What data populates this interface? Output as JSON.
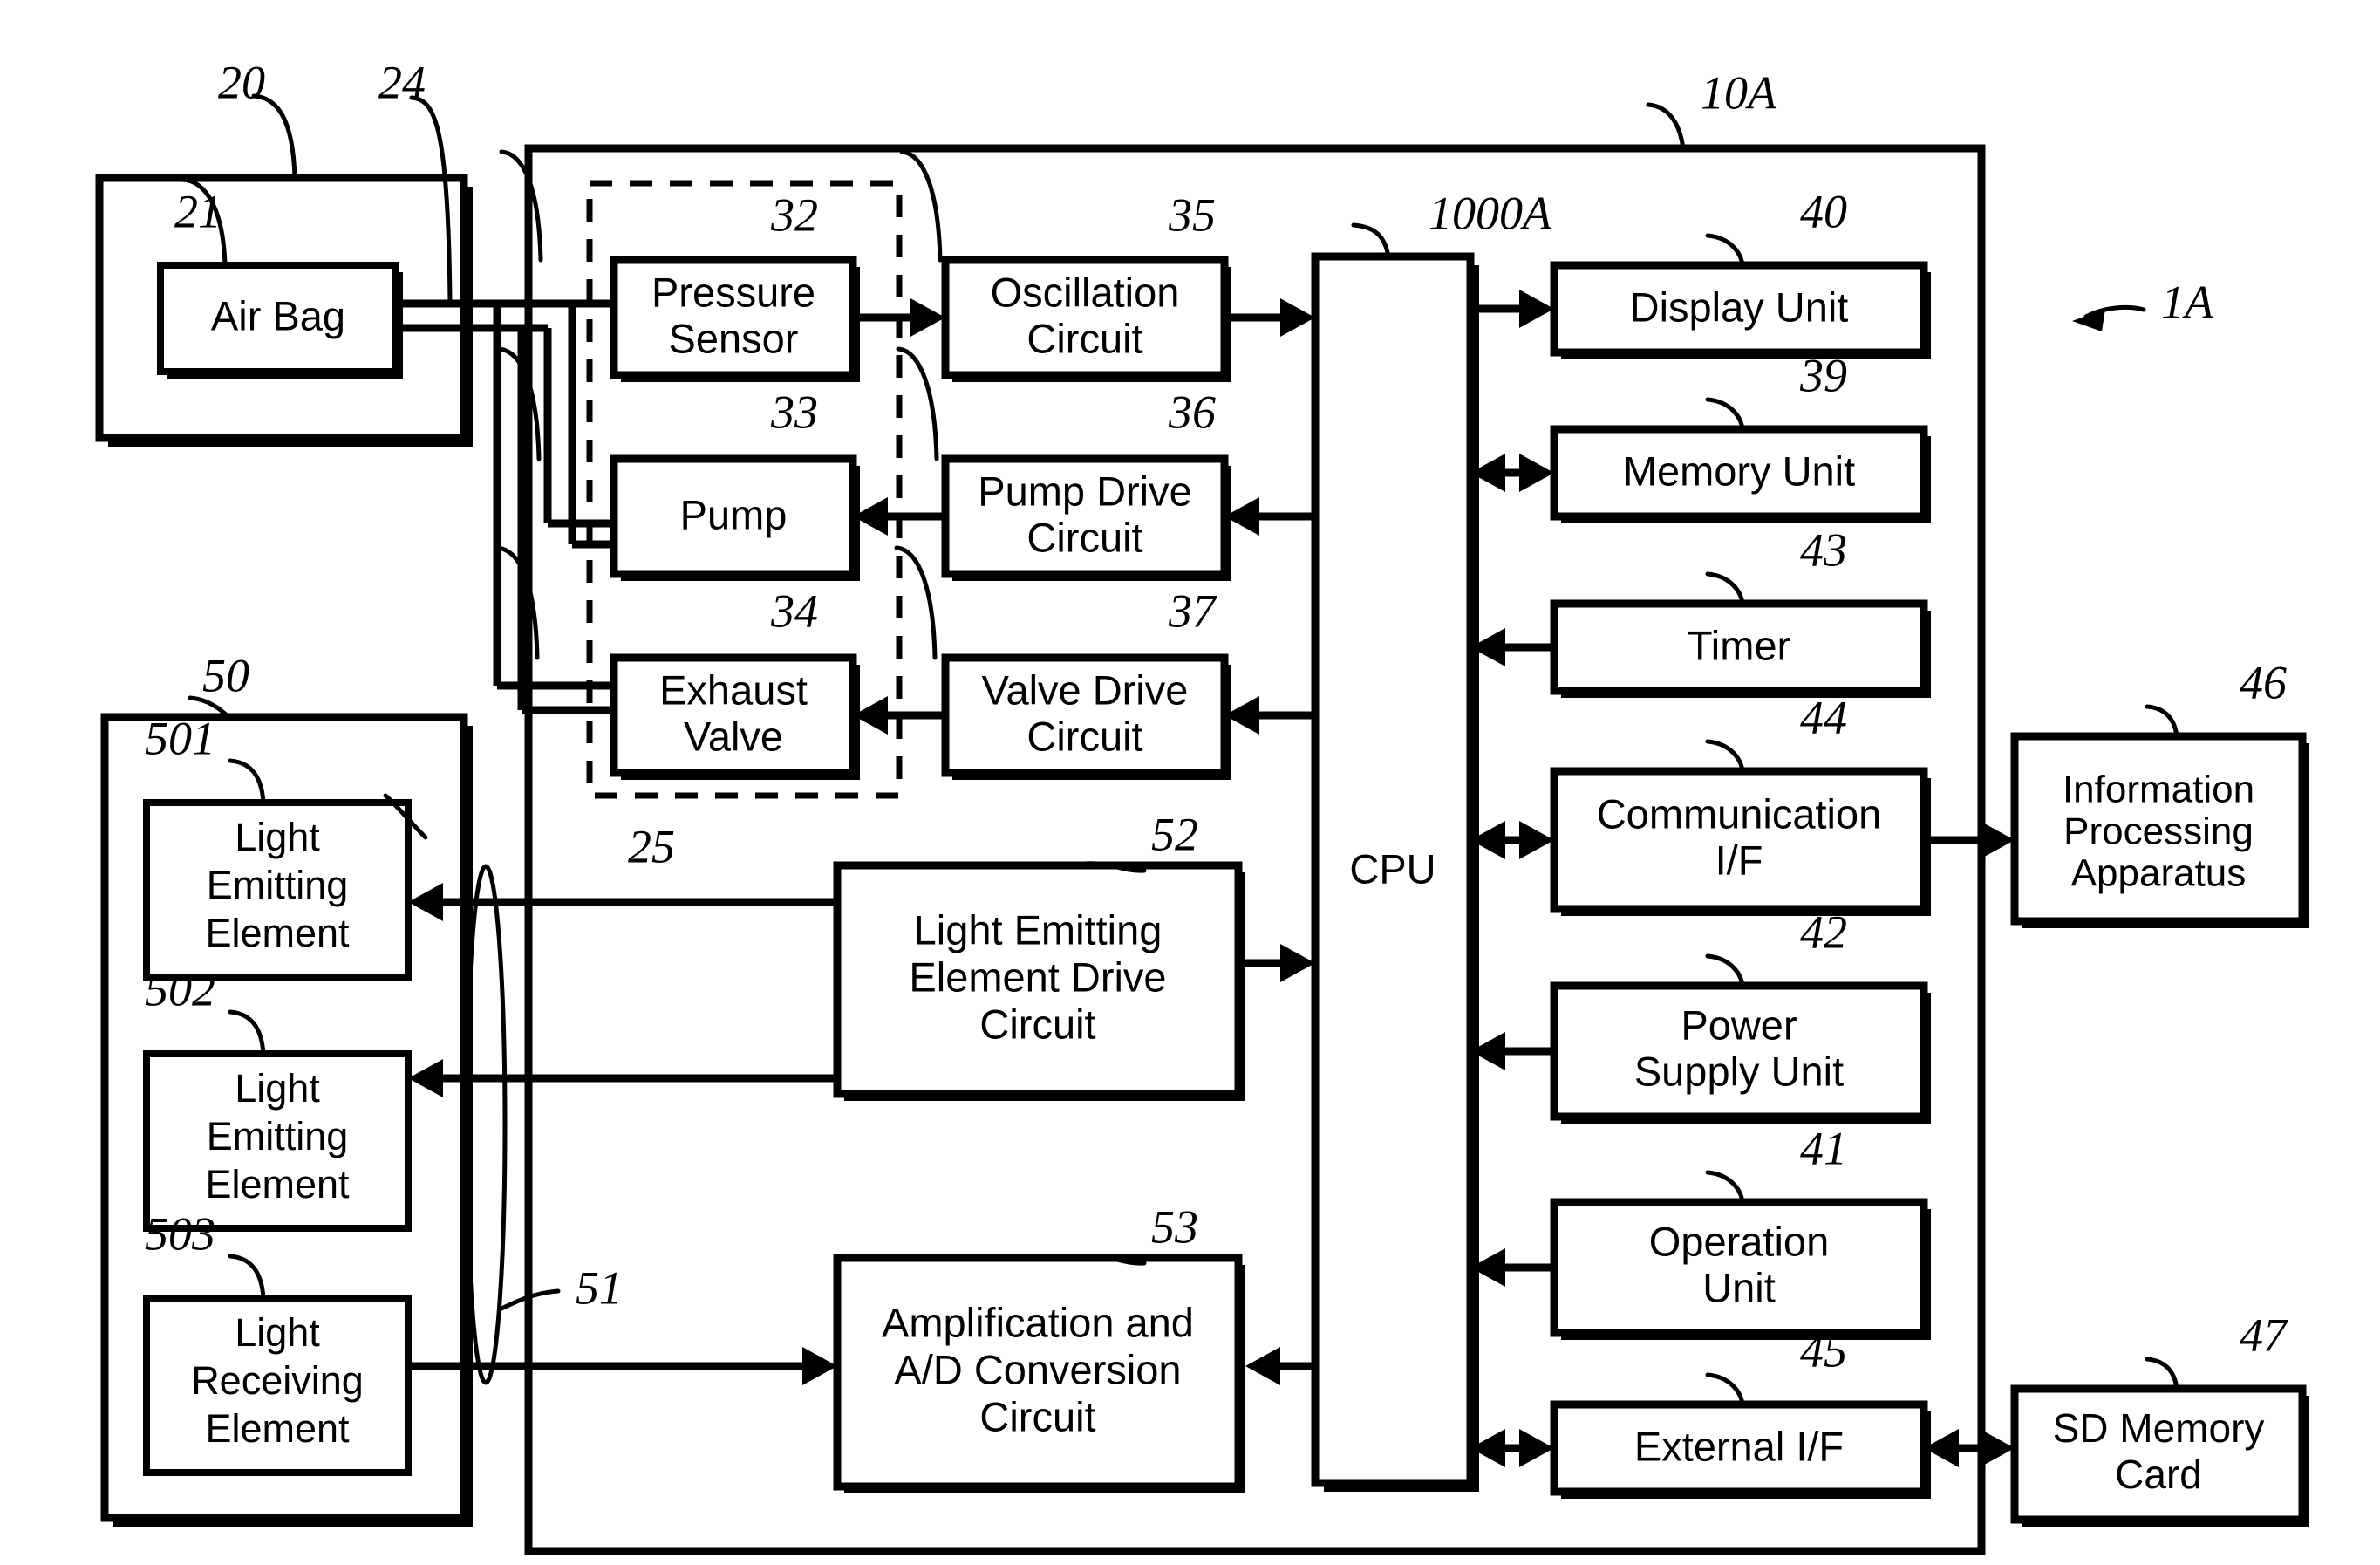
{
  "figure": {
    "kind": "patent-block-diagram",
    "overall_ref": "1A",
    "stroke_color": "#000000",
    "background_color": "#ffffff"
  },
  "containers": {
    "cuff_unit": {
      "ref": "20",
      "label": ""
    },
    "main_unit": {
      "ref": "10A",
      "label": ""
    },
    "air_system": {
      "ref": "25",
      "label": "",
      "style": "dashed"
    },
    "sensor_unit": {
      "ref": "50",
      "label": ""
    },
    "tube": {
      "ref": "24",
      "label": ""
    },
    "signal_bundle": {
      "ref": "51",
      "label": ""
    }
  },
  "blocks": [
    {
      "id": "air_bag",
      "ref": "21",
      "lines": [
        "Air Bag"
      ]
    },
    {
      "id": "pressure_sensor",
      "ref": "32",
      "lines": [
        "Pressure",
        "Sensor"
      ]
    },
    {
      "id": "pump",
      "ref": "33",
      "lines": [
        "Pump"
      ]
    },
    {
      "id": "exhaust_valve",
      "ref": "34",
      "lines": [
        "Exhaust",
        "Valve"
      ]
    },
    {
      "id": "oscillation",
      "ref": "35",
      "lines": [
        "Oscillation",
        "Circuit"
      ]
    },
    {
      "id": "pump_drive",
      "ref": "36",
      "lines": [
        "Pump Drive",
        "Circuit"
      ]
    },
    {
      "id": "valve_drive",
      "ref": "37",
      "lines": [
        "Valve Drive",
        "Circuit"
      ]
    },
    {
      "id": "cpu",
      "ref": "1000A",
      "lines": [
        "CPU"
      ]
    },
    {
      "id": "display_unit",
      "ref": "40",
      "lines": [
        "Display Unit"
      ]
    },
    {
      "id": "memory_unit",
      "ref": "39",
      "lines": [
        "Memory Unit"
      ]
    },
    {
      "id": "timer",
      "ref": "43",
      "lines": [
        "Timer"
      ]
    },
    {
      "id": "comm_if",
      "ref": "44",
      "lines": [
        "Communication",
        "I/F"
      ]
    },
    {
      "id": "power_supply",
      "ref": "42",
      "lines": [
        "Power",
        "Supply Unit"
      ]
    },
    {
      "id": "operation_unit",
      "ref": "41",
      "lines": [
        "Operation",
        "Unit"
      ]
    },
    {
      "id": "external_if",
      "ref": "45",
      "lines": [
        "External I/F"
      ]
    },
    {
      "id": "info_apparatus",
      "ref": "46",
      "lines": [
        "Information",
        "Processing",
        "Apparatus"
      ]
    },
    {
      "id": "sd_card",
      "ref": "47",
      "lines": [
        "SD Memory",
        "Card"
      ]
    },
    {
      "id": "led1",
      "ref": "501",
      "lines": [
        "Light",
        "Emitting",
        "Element"
      ]
    },
    {
      "id": "led2",
      "ref": "502",
      "lines": [
        "Light",
        "Emitting",
        "Element"
      ]
    },
    {
      "id": "photodiode",
      "ref": "503",
      "lines": [
        "Light",
        "Receiving",
        "Element"
      ]
    },
    {
      "id": "led_drive",
      "ref": "52",
      "lines": [
        "Light Emitting",
        "Element Drive",
        "Circuit"
      ]
    },
    {
      "id": "amp_adc",
      "ref": "53",
      "lines": [
        "Amplification and",
        "A/D Conversion",
        "Circuit"
      ]
    }
  ],
  "ref_numbers": [
    "20",
    "21",
    "24",
    "25",
    "32",
    "33",
    "34",
    "35",
    "36",
    "37",
    "39",
    "40",
    "41",
    "42",
    "43",
    "44",
    "45",
    "46",
    "47",
    "50",
    "501",
    "502",
    "503",
    "51",
    "52",
    "53",
    "1000A",
    "10A",
    "1A"
  ],
  "connections": [
    {
      "from": "air_bag",
      "to": "pressure_sensor",
      "type": "air-tube"
    },
    {
      "from": "air_bag",
      "to": "pump",
      "type": "air-tube"
    },
    {
      "from": "air_bag",
      "to": "exhaust_valve",
      "type": "air-tube"
    },
    {
      "from": "pressure_sensor",
      "to": "oscillation",
      "type": "arrow"
    },
    {
      "from": "oscillation",
      "to": "cpu",
      "type": "arrow"
    },
    {
      "from": "cpu",
      "to": "pump_drive",
      "type": "arrow"
    },
    {
      "from": "pump_drive",
      "to": "pump",
      "type": "arrow"
    },
    {
      "from": "cpu",
      "to": "valve_drive",
      "type": "arrow"
    },
    {
      "from": "valve_drive",
      "to": "exhaust_valve",
      "type": "arrow"
    },
    {
      "from": "cpu",
      "to": "display_unit",
      "type": "arrow"
    },
    {
      "from": "cpu",
      "to": "memory_unit",
      "type": "double-arrow"
    },
    {
      "from": "timer",
      "to": "cpu",
      "type": "arrow"
    },
    {
      "from": "cpu",
      "to": "comm_if",
      "type": "double-arrow"
    },
    {
      "from": "comm_if",
      "to": "info_apparatus",
      "type": "arrow"
    },
    {
      "from": "power_supply",
      "to": "cpu",
      "type": "arrow"
    },
    {
      "from": "operation_unit",
      "to": "cpu",
      "type": "arrow"
    },
    {
      "from": "cpu",
      "to": "external_if",
      "type": "double-arrow"
    },
    {
      "from": "external_if",
      "to": "sd_card",
      "type": "double-arrow"
    },
    {
      "from": "cpu",
      "to": "led_drive",
      "type": "arrow"
    },
    {
      "from": "led_drive",
      "to": "led1",
      "type": "arrow"
    },
    {
      "from": "led_drive",
      "to": "led2",
      "type": "arrow"
    },
    {
      "from": "photodiode",
      "to": "amp_adc",
      "type": "arrow"
    },
    {
      "from": "cpu",
      "to": "amp_adc",
      "type": "arrow"
    }
  ]
}
